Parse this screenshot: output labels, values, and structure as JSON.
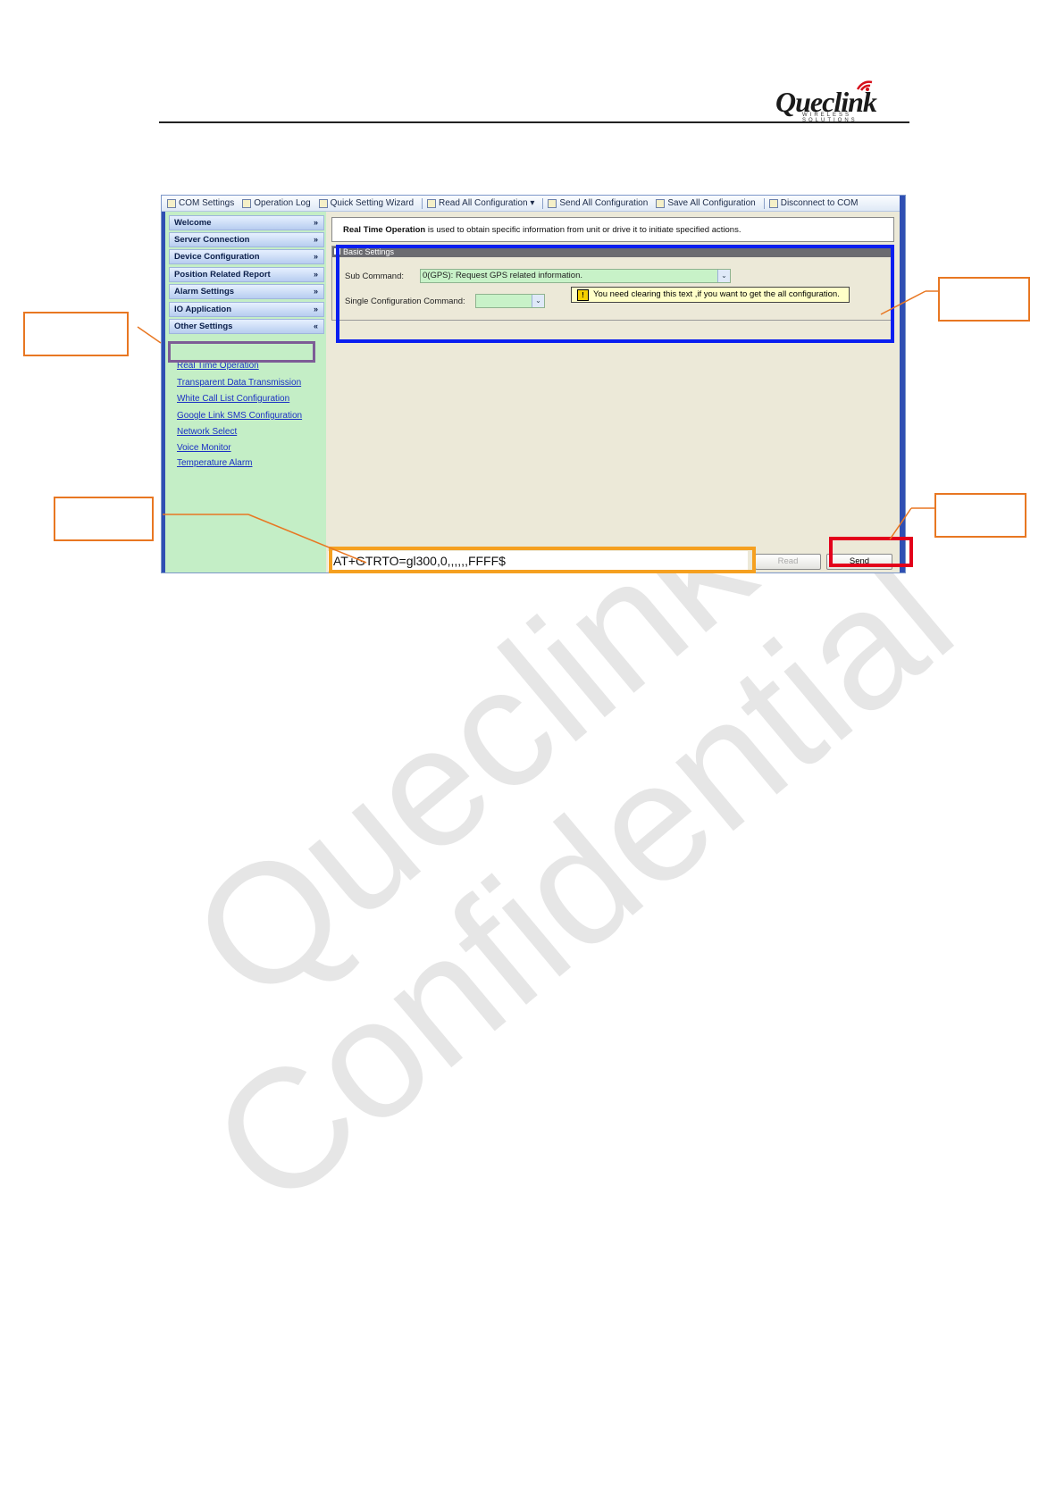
{
  "header": {
    "logo_text": "Queclink",
    "logo_tagline": "WIRELESS SOLUTIONS"
  },
  "watermark": {
    "line1": "Queclink",
    "line2": "Confidential"
  },
  "toolbar": {
    "items": [
      {
        "label": "COM Settings",
        "icon": "com-settings-icon"
      },
      {
        "label": "Operation Log",
        "icon": "log-icon"
      },
      {
        "label": "Quick Setting Wizard",
        "icon": "wizard-icon"
      },
      {
        "label": "Read All Configuration",
        "icon": "read-icon",
        "dropdown": "▾"
      },
      {
        "label": "Send All Configuration",
        "icon": "send-icon"
      },
      {
        "label": "Save All Configuration",
        "icon": "save-icon"
      },
      {
        "label": "Disconnect to COM",
        "icon": "disconnect-icon"
      }
    ]
  },
  "sidebar": {
    "menus": [
      {
        "label": "Welcome",
        "chevron": "»"
      },
      {
        "label": "Server Connection",
        "chevron": "»"
      },
      {
        "label": "Device Configuration",
        "chevron": "»"
      },
      {
        "label": "Position Related Report",
        "chevron": "»"
      },
      {
        "label": "Alarm Settings",
        "chevron": "»"
      },
      {
        "label": "IO Application",
        "chevron": "»"
      },
      {
        "label": "Other Settings",
        "chevron": "«"
      }
    ],
    "sub_items": [
      "Real Time Operation",
      "Transparent Data Transmission",
      "White Call List Configuration",
      "Google Link SMS Configuration",
      "Network Select",
      "Voice Monitor",
      "Temperature Alarm"
    ]
  },
  "main": {
    "description_bold": "Real Time Operation",
    "description_rest": " is used to obtain specific information from unit or drive it to initiate specified actions.",
    "basic_settings_title": "Basic Settings",
    "sub_command_label": "Sub Command:",
    "sub_command_value": "0(GPS): Request GPS related information.",
    "single_config_label": "Single Configuration Command:",
    "single_config_value": "",
    "hint_text": "You need clearing this text ,if you want to get the all configuration.",
    "hint_icon": "!",
    "command_text": "AT+GTRTO=gl300,0,,,,,,FFFF$",
    "read_button": "Read",
    "send_button": "Send",
    "arrow_glyph": "⌄"
  },
  "colors": {
    "sidebar_bg": "#c4eec6",
    "highlight_purple": "#7d5c96",
    "highlight_blue": "#0a1ff0",
    "highlight_orange": "#f5a020",
    "highlight_red": "#e3001b",
    "callout": "#e87722"
  }
}
